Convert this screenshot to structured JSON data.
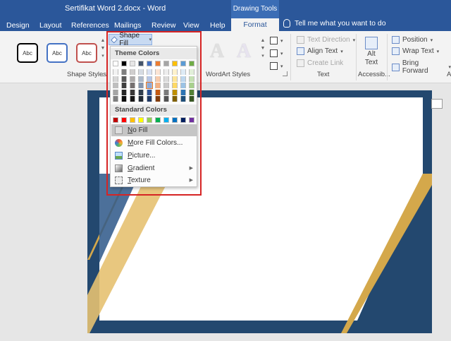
{
  "window": {
    "title": "Sertifikat Word 2.docx - Word",
    "context_tab": "Drawing Tools"
  },
  "tabs": [
    "Design",
    "Layout",
    "References",
    "Mailings",
    "Review",
    "View",
    "Help"
  ],
  "active_tab": "Format",
  "tell_me": "Tell me what you want to do",
  "ribbon": {
    "shape_styles": {
      "sample_label": "Abc",
      "label": "Shape Styles"
    },
    "shape_fill_label": "Shape Fill",
    "wordart_label": "WordArt Styles",
    "text_group": {
      "text_direction": "Text Direction",
      "align_text": "Align Text",
      "create_link": "Create Link",
      "label": "Text"
    },
    "accessibility": {
      "alt_text_line1": "Alt",
      "alt_text_line2": "Text",
      "label": "Accessib..."
    },
    "arrange": {
      "position": "Position",
      "wrap_text": "Wrap Text",
      "bring_forward": "Bring Forward",
      "label": "A"
    }
  },
  "shape_fill_menu": {
    "theme_colors_label": "Theme Colors",
    "standard_colors_label": "Standard Colors",
    "theme_base": [
      "#ffffff",
      "#000000",
      "#e7e6e6",
      "#44546a",
      "#4472c4",
      "#ed7d31",
      "#a5a5a5",
      "#ffc000",
      "#5b9bd5",
      "#70ad47"
    ],
    "theme_rows": [
      [
        "#f2f2f2",
        "#7f7f7f",
        "#d0cece",
        "#d6dce4",
        "#d9e2f3",
        "#fbe5d5",
        "#ededed",
        "#fff2cc",
        "#deebf6",
        "#e2efd9"
      ],
      [
        "#d8d8d8",
        "#595959",
        "#aeabab",
        "#adb9ca",
        "#b4c6e7",
        "#f7cbac",
        "#dbdbdb",
        "#fee599",
        "#bdd7ee",
        "#c5e0b3"
      ],
      [
        "#bfbfbf",
        "#3f3f3f",
        "#757070",
        "#8496b0",
        "#8eaadb",
        "#f4b183",
        "#c9c9c9",
        "#ffd965",
        "#9cc3e5",
        "#a8d08d"
      ],
      [
        "#a5a5a5",
        "#262626",
        "#3a3838",
        "#323f4f",
        "#2f5496",
        "#c55a11",
        "#7b7b7b",
        "#bf9000",
        "#2e75b5",
        "#538135"
      ],
      [
        "#7f7f7f",
        "#0c0c0c",
        "#171616",
        "#222a35",
        "#1e3864",
        "#833c0b",
        "#525252",
        "#7f6000",
        "#1e4e79",
        "#375623"
      ]
    ],
    "standard_colors": [
      "#c00000",
      "#ff0000",
      "#ffc000",
      "#ffff00",
      "#92d050",
      "#00b050",
      "#00b0f0",
      "#0070c0",
      "#002060",
      "#7030a0"
    ],
    "items": [
      "No Fill",
      "More Fill Colors...",
      "Picture...",
      "Gradient",
      "Texture"
    ]
  },
  "colors": {
    "accent": "#2b579a",
    "highlight_box": "#d62424",
    "page_navy": "#23486f",
    "gold": "#d4a84b"
  }
}
